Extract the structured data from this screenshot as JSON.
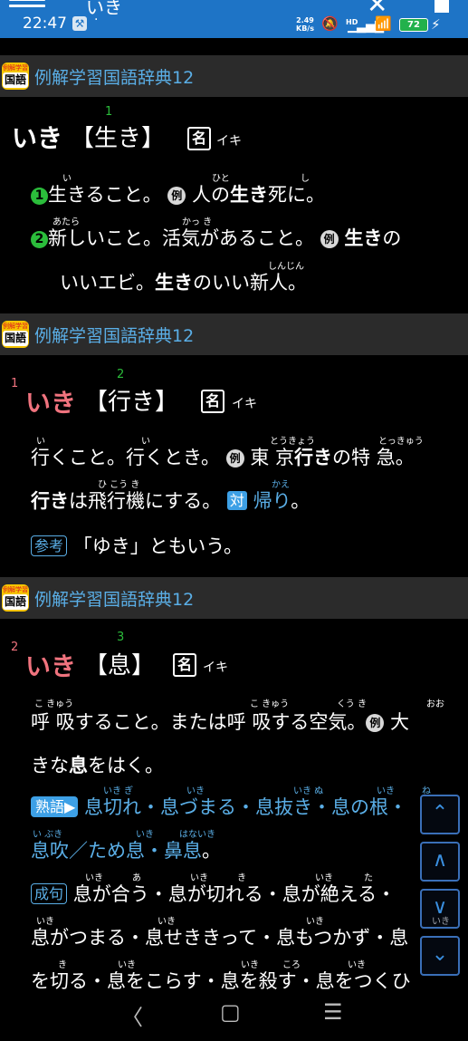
{
  "status_bar": {
    "title": "いき",
    "time": "22:47",
    "net_rate": "2.49",
    "net_unit": "KB/s",
    "hd": "HD",
    "battery": "72",
    "dot": "·"
  },
  "entries": [
    {
      "dict_name": "例解学習国語辞典12",
      "logo_top": "例解学習",
      "logo_main": "国語",
      "headword": "いき",
      "kanji": "【生き】",
      "sup": "1",
      "pos": "名",
      "reading": "イキ",
      "lines": {
        "l1": "生きること。",
        "l1b": "人の",
        "l1c": "生き",
        "l1d": "死に。",
        "l2": "新しいこと。活気があること。",
        "l2b": "生き",
        "l2c": "の",
        "l3": "いいエビ。",
        "l3b": "生き",
        "l3c": "のいい新人。"
      },
      "num1": "1",
      "num2": "2",
      "rei": "例",
      "ruby": {
        "r1": "い",
        "r2": "ひと",
        "r3": "し",
        "r4": "あたら",
        "r5": "かっ き",
        "r6": "しんじん"
      }
    },
    {
      "dict_name": "例解学習国語辞典12",
      "logo_top": "例解学習",
      "logo_main": "国語",
      "prefix_sup": "1",
      "headword": "いき",
      "kanji": "【行き】",
      "sup": "2",
      "pos": "名",
      "reading": "イキ",
      "lines": {
        "l1": "行くこと。行くとき。",
        "l1b": "東 京",
        "l1c": "行き",
        "l1d": "の特 急。",
        "l2": "行き",
        "l2b": "は飛行機にする。",
        "l2c": "帰り",
        "l2d": "。",
        "l3": "「ゆき」ともいう。"
      },
      "rei": "例",
      "tai": "対",
      "sanko": "参考",
      "ruby": {
        "r1": "い",
        "r2": "い",
        "r3": "とうきょう",
        "r4": "とっきゅう",
        "r5": "ひ こう き",
        "r6": "かえ"
      }
    },
    {
      "dict_name": "例解学習国語辞典12",
      "logo_top": "例解学習",
      "logo_main": "国語",
      "prefix_sup": "2",
      "headword": "いき",
      "kanji": "【息】",
      "sup": "3",
      "pos": "名",
      "reading": "イキ",
      "lines": {
        "l1": "呼 吸すること。または呼 吸する空気。",
        "l1b": "大",
        "l2": "きな",
        "l2b": "息",
        "l2c": "をはく。",
        "l3": "息切れ・息づまる・息抜き・息の根・",
        "l4": "息吹／ため息・鼻息",
        "l4b": "。",
        "l5": "息が合う・息が切れる・息が絶える・",
        "l6": "息がつまる・息せききって・息もつかず・息",
        "l7": "を切る・息をこらす・息を殺す・息をつくひ"
      },
      "rei": "例",
      "jukugo": "熟語▶",
      "seiku": "成句",
      "ruby": {
        "r1": "こ きゅう",
        "r2": "こ きゅう",
        "r3": "くう き",
        "r4": "おお",
        "r5": "いき ぎ",
        "r6": "いき",
        "r7": "いき ぬ",
        "r8": "いき",
        "r9": "ね",
        "r10": "い ぶき",
        "r11": "いき",
        "r12": "はないき",
        "r13": "いき",
        "r14": "あ",
        "r15": "いき",
        "r16": "き",
        "r17": "いき",
        "r18": "た",
        "r19": "いき",
        "r20": "いき",
        "r21": "いき",
        "r22": "いき",
        "r23": "き",
        "r24": "いき",
        "r25": "いき",
        "r26": "ころ",
        "r27": "いき"
      }
    }
  ],
  "nav_buttons": {
    "top": "⌃",
    "up": "∧",
    "down": "∨",
    "bottom": "⌄"
  },
  "system_nav": {
    "back": "〈",
    "home": "▢",
    "recents": "☰"
  },
  "colors": {
    "status_bar": "#1e74c6",
    "dict_header": "#2b2b2b",
    "accent_blue": "#5aaee6",
    "headword_red": "#f0737e",
    "number_green": "#2bbd3b"
  }
}
